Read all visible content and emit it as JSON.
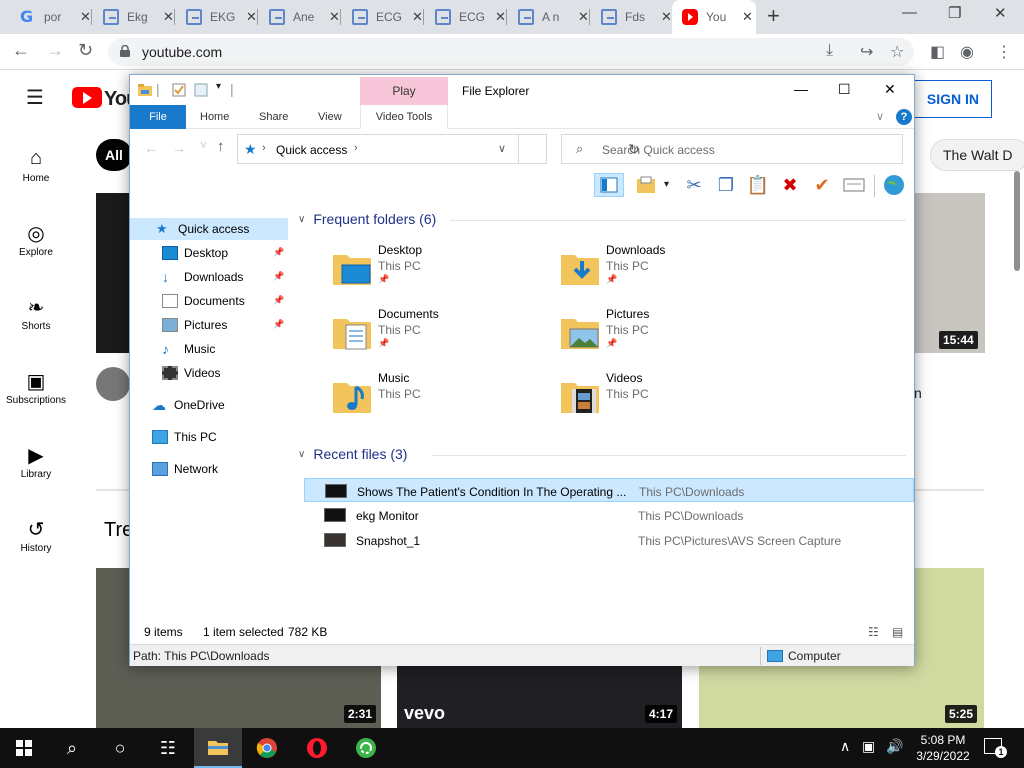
{
  "browser": {
    "tabs": [
      {
        "label": "por",
        "icon": "google-icon"
      },
      {
        "label": "Ekg",
        "icon": "doc-icon"
      },
      {
        "label": "EKG",
        "icon": "doc-icon"
      },
      {
        "label": "Ane",
        "icon": "doc-icon"
      },
      {
        "label": "ECG",
        "icon": "doc-icon"
      },
      {
        "label": "ECG",
        "icon": "doc-icon"
      },
      {
        "label": "A n",
        "icon": "doc-icon"
      },
      {
        "label": "Fds",
        "icon": "doc-icon"
      },
      {
        "label": "You",
        "icon": "youtube-icon",
        "active": true
      }
    ],
    "close_glyph": "✕",
    "new_tab_glyph": "+",
    "url": "youtube.com"
  },
  "youtube": {
    "logo_word": "You",
    "signin_label": "SIGN IN",
    "chip_all": "All",
    "chip_walt": "The Walt D",
    "nav": [
      {
        "label": "Home",
        "icon": "home-icon"
      },
      {
        "label": "Explore",
        "icon": "compass-icon"
      },
      {
        "label": "Shorts",
        "icon": "shorts-icon"
      },
      {
        "label": "Subscriptions",
        "icon": "subscriptions-icon"
      },
      {
        "label": "Library",
        "icon": "library-icon"
      },
      {
        "label": "History",
        "icon": "history-icon"
      }
    ],
    "durations": [
      "15:44",
      "2:31",
      "4:17",
      "5:25"
    ],
    "trending_partial": "Tre",
    "channel_letter": "n",
    "vevo": "vevo"
  },
  "explorer": {
    "title": "File Explorer",
    "context_tab": "Play",
    "ribbon_tabs": [
      "File",
      "Home",
      "Share",
      "View",
      "Video Tools"
    ],
    "address": "Quick access",
    "search_placeholder": "Search Quick access",
    "nav": {
      "quick_access": "Quick access",
      "pinned": [
        "Desktop",
        "Downloads",
        "Documents",
        "Pictures"
      ],
      "unpinned": [
        "Music",
        "Videos"
      ],
      "onedrive": "OneDrive",
      "thispc": "This PC",
      "network": "Network"
    },
    "frequent_header": "Frequent folders (6)",
    "frequent": [
      {
        "name": "Desktop",
        "location": "This PC",
        "pinned": true
      },
      {
        "name": "Downloads",
        "location": "This PC",
        "pinned": true
      },
      {
        "name": "Documents",
        "location": "This PC",
        "pinned": true
      },
      {
        "name": "Pictures",
        "location": "This PC",
        "pinned": true
      },
      {
        "name": "Music",
        "location": "This PC",
        "pinned": false
      },
      {
        "name": "Videos",
        "location": "This PC",
        "pinned": false
      }
    ],
    "recent_header": "Recent files (3)",
    "recent": [
      {
        "name": "Shows The Patient's Condition In The Operating ...",
        "path": "This PC\\Downloads",
        "selected": true
      },
      {
        "name": "ekg Monitor",
        "path": "This PC\\Downloads",
        "selected": false
      },
      {
        "name": "Snapshot_1",
        "path": "This PC\\Pictures\\AVS Screen Capture",
        "selected": false
      }
    ],
    "status": {
      "items": "9 items",
      "selected": "1 item selected",
      "size": "782 KB"
    },
    "details_path": "Path: This PC\\Downloads",
    "details_computer": "Computer"
  },
  "taskbar": {
    "time": "5:08 PM",
    "date": "3/29/2022",
    "notification_count": "1"
  }
}
